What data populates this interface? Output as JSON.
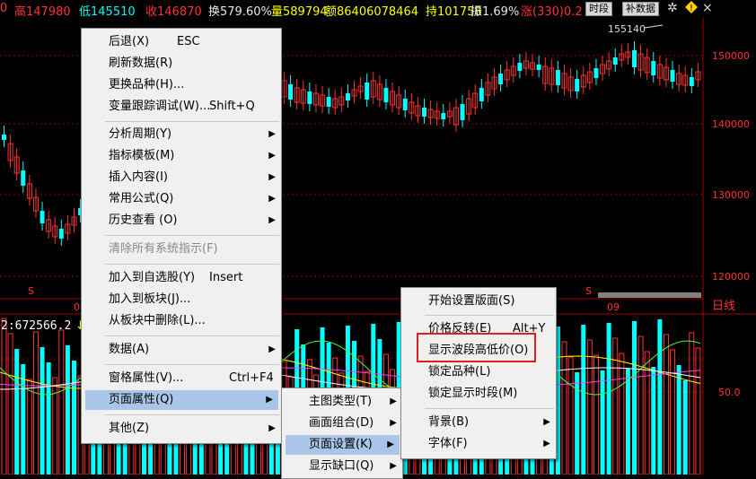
{
  "topbar": {
    "t0": "0",
    "high": "高147980",
    "low": "低145510",
    "close": "收146870",
    "turnover": "换579.60%",
    "volume": "量589794",
    "amount": "额86406078464",
    "openint": "持101758",
    "amplitude": "振1.69%",
    "change": "涨(330)0.2",
    "btn_timeshare": "时段",
    "btn_supplement": "补数据"
  },
  "chart": {
    "price_labels": [
      "150000",
      "140000",
      "130000",
      "120000"
    ],
    "high_mark": "155140",
    "indicator_label": "2:672566.2",
    "indicator_level": "50.0",
    "date_tag_1": "08",
    "date_tag_2": "09",
    "period_label": "日线",
    "s_marker": "S"
  },
  "colors": {
    "up": "#ff3232",
    "down": "#00ffff",
    "bg": "#000000",
    "grid": "#8b0000",
    "highlight": "#a9c6e8"
  },
  "menu1": {
    "items": [
      {
        "label": "后退(X)",
        "shortcut": "ESC"
      },
      {
        "label": "刷新数据(R)"
      },
      {
        "label": "更换品种(H)..."
      },
      {
        "label": "变量跟踪调试(W)...",
        "shortcut": "Shift+Q"
      },
      {
        "label": "分析周期(Y)"
      },
      {
        "label": "指标模板(M)"
      },
      {
        "label": "插入内容(I)"
      },
      {
        "label": "常用公式(Q)"
      },
      {
        "label": "历史查看 (O)"
      },
      {
        "label": "清除所有系统指示(F)"
      },
      {
        "label": "加入到自选股(Y)",
        "shortcut": "Insert"
      },
      {
        "label": "加入到板块(J)..."
      },
      {
        "label": "从板块中删除(L)..."
      },
      {
        "label": "数据(A)"
      },
      {
        "label": "窗格属性(V)...",
        "shortcut": "Ctrl+F4"
      },
      {
        "label": "页面属性(Q)"
      },
      {
        "label": "其他(Z)"
      }
    ]
  },
  "menu2": {
    "items": [
      {
        "label": "主图类型(T)"
      },
      {
        "label": "画面组合(D)"
      },
      {
        "label": "页面设置(K)"
      },
      {
        "label": "显示缺口(Q)"
      }
    ]
  },
  "menu3": {
    "items": [
      {
        "label": "开始设置版面(S)"
      },
      {
        "label": "价格反转(E)",
        "shortcut": "Alt+Y"
      },
      {
        "label": "显示波段高低价(O)"
      },
      {
        "label": "锁定品种(L)"
      },
      {
        "label": "锁定显示时段(M)"
      },
      {
        "label": "背景(B)"
      },
      {
        "label": "字体(F)"
      }
    ]
  }
}
